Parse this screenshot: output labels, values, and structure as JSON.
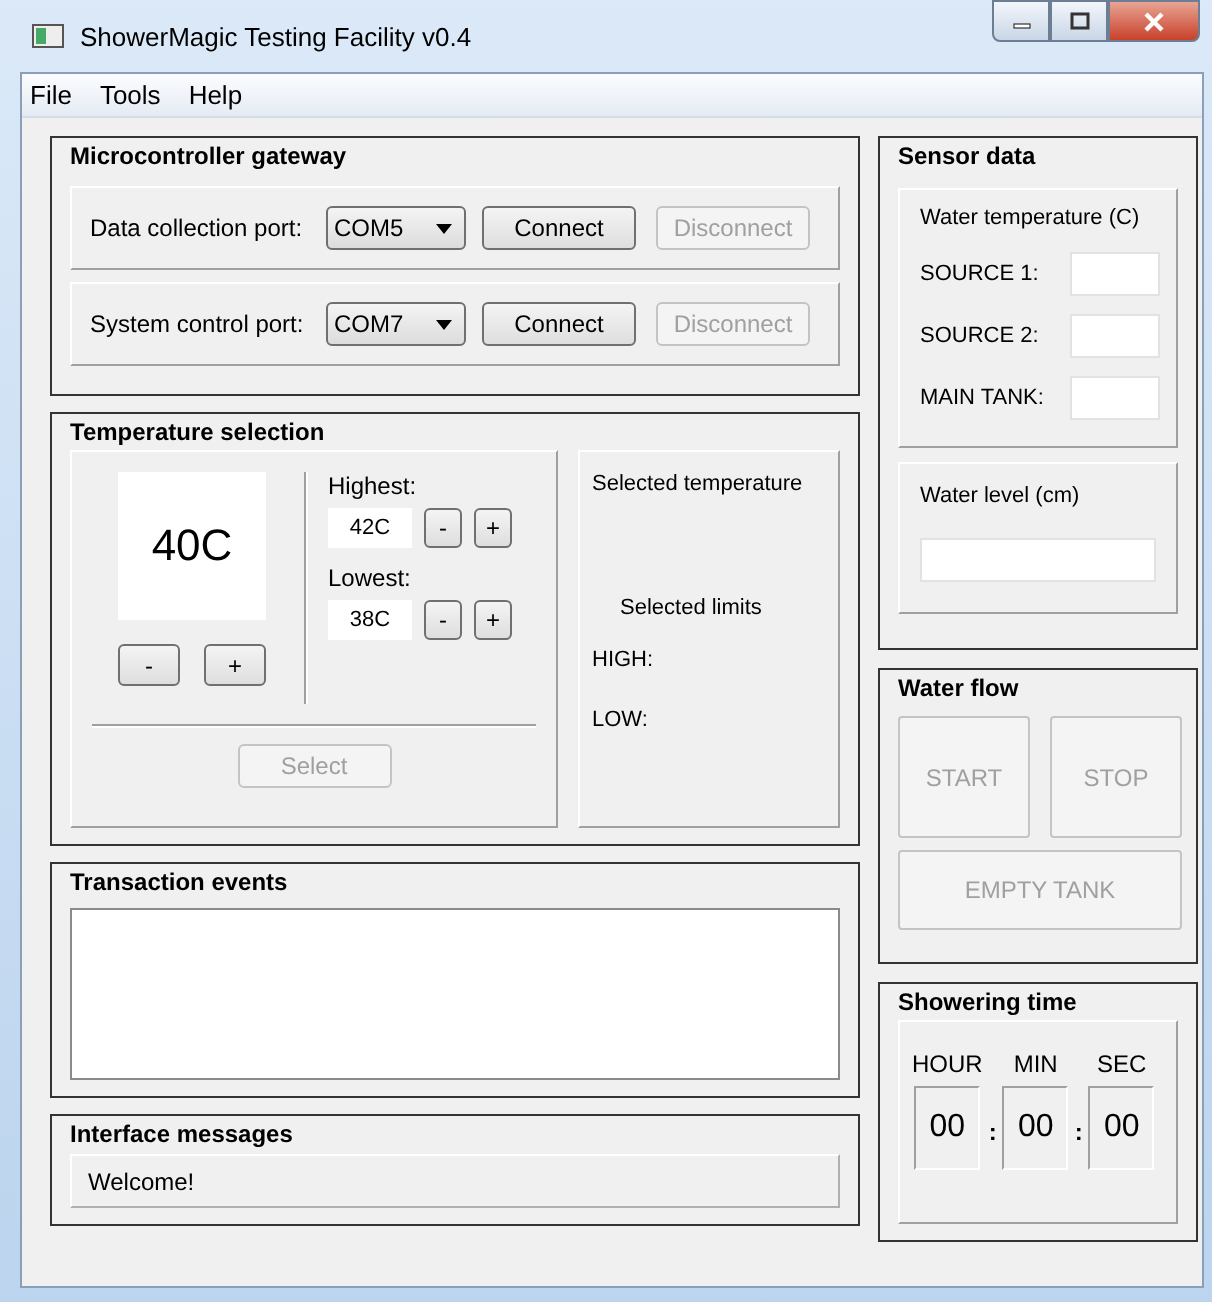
{
  "window": {
    "title": "ShowerMagic Testing Facility v0.4"
  },
  "menu": [
    "File",
    "Tools",
    "Help"
  ],
  "gateway": {
    "title": "Microcontroller gateway",
    "ports": [
      {
        "label": "Data collection port:",
        "value": "COM5",
        "buttons": [
          {
            "label": "Connect",
            "disabled": false
          },
          {
            "label": "Disconnect",
            "disabled": true
          }
        ]
      },
      {
        "label": "System control port:",
        "value": "COM7",
        "buttons": [
          {
            "label": "Connect",
            "disabled": false
          },
          {
            "label": "Disconnect",
            "disabled": true
          }
        ]
      }
    ]
  },
  "temperature": {
    "title": "Temperature selection",
    "current": "40C",
    "current_buttons": [
      {
        "label": "-",
        "disabled": false
      },
      {
        "label": "+",
        "disabled": false
      }
    ],
    "limits": [
      {
        "label": "Highest:",
        "value": "42C",
        "buttons": [
          {
            "label": "-",
            "disabled": false
          },
          {
            "label": "+",
            "disabled": false
          }
        ]
      },
      {
        "label": "Lowest:",
        "value": "38C",
        "buttons": [
          {
            "label": "-",
            "disabled": false
          },
          {
            "label": "+",
            "disabled": false
          }
        ]
      }
    ],
    "select": {
      "label": "Select",
      "disabled": true
    },
    "selected_temperature": "Selected temperature",
    "selected_limits": "Selected limits",
    "high": "HIGH:",
    "low": "LOW:"
  },
  "transactions": {
    "title": "Transaction events"
  },
  "messages": {
    "title": "Interface messages",
    "text": "Welcome!"
  },
  "sensor": {
    "title": "Sensor data",
    "water_temperature": "Water temperature (C)",
    "sources": [
      {
        "label": "SOURCE 1:"
      },
      {
        "label": "SOURCE 2:"
      },
      {
        "label": "MAIN TANK:"
      }
    ],
    "water_level": "Water level (cm)"
  },
  "flow": {
    "title": "Water flow",
    "buttons": [
      {
        "label": "START",
        "disabled": true
      },
      {
        "label": "STOP",
        "disabled": true
      },
      {
        "label": "EMPTY TANK",
        "disabled": true
      }
    ]
  },
  "timer": {
    "title": "Showering time",
    "units": [
      {
        "label": "HOUR",
        "value": "00",
        "separator": ":"
      },
      {
        "label": "MIN",
        "value": "00",
        "separator": ":"
      },
      {
        "label": "SEC",
        "value": "00"
      }
    ]
  }
}
